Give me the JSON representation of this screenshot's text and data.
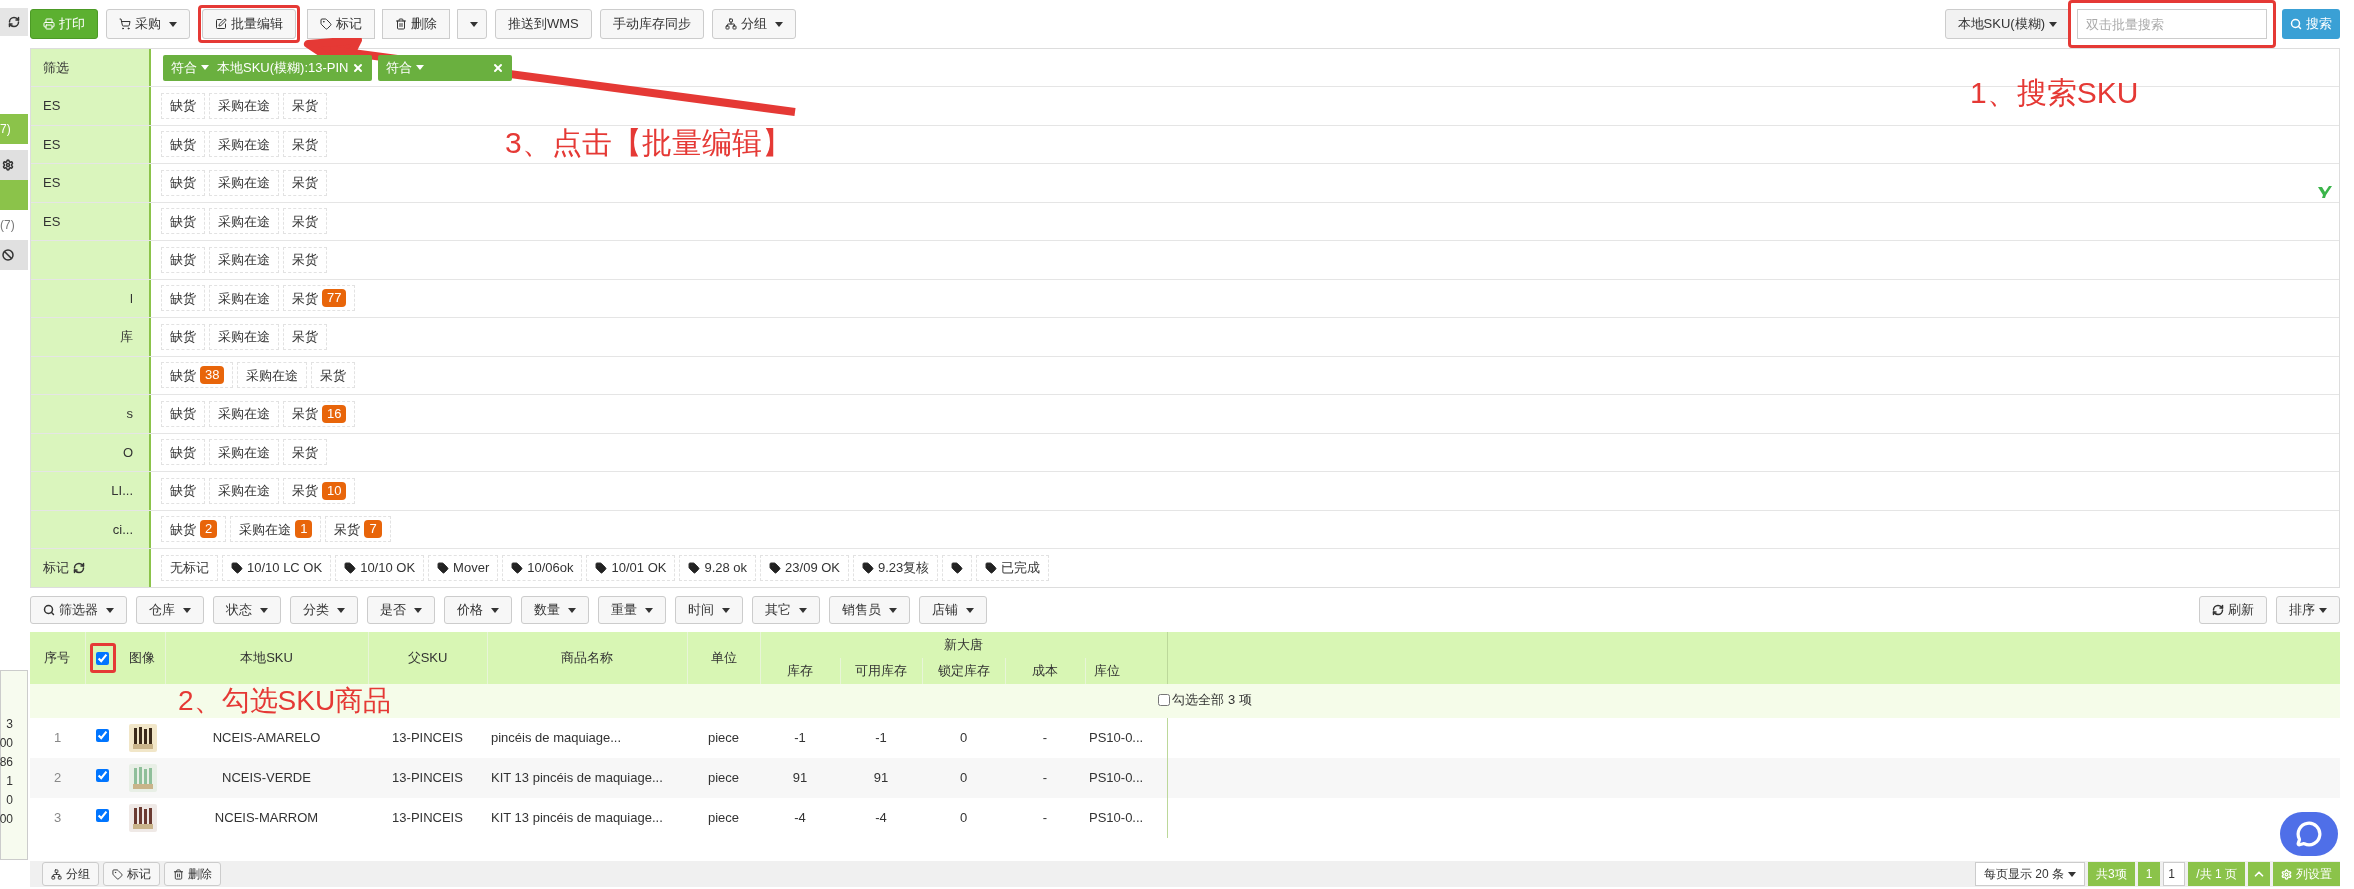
{
  "left_strip": {
    "badge": "7)",
    "count": "(7)",
    "numbers": [
      "3",
      "00",
      "86",
      "1",
      "0",
      "00"
    ]
  },
  "toolbar": {
    "buttons": [
      {
        "label": "打印",
        "kind": "primary",
        "highlighted": false
      },
      {
        "label": "采购",
        "kind": "dropdown",
        "highlighted": false
      },
      {
        "label": "批量编辑",
        "kind": "plain",
        "highlighted": true
      },
      {
        "label": "标记",
        "kind": "group",
        "highlighted": false
      },
      {
        "label": "删除",
        "kind": "group",
        "highlighted": false
      },
      {
        "kind": "caret",
        "highlighted": false
      },
      {
        "label": "推送到WMS",
        "kind": "plain",
        "highlighted": false
      },
      {
        "label": "手动库存同步",
        "kind": "plain",
        "highlighted": false
      },
      {
        "label": "分组",
        "kind": "dropdown",
        "highlighted": false
      }
    ]
  },
  "search": {
    "mode": "本地SKU(模糊)",
    "placeholder": "双击批量搜索",
    "button": "搜索",
    "highlighted": true
  },
  "filter": {
    "label": "筛选",
    "chips": [
      {
        "prefix": "符合",
        "text": "本地SKU(模糊):13-PIN"
      },
      {
        "prefix": "符合"
      }
    ]
  },
  "warehouses": [
    {
      "name": "ES",
      "tags": [
        {
          "label": "缺货"
        },
        {
          "label": "采购在途"
        },
        {
          "label": "呆货"
        }
      ]
    },
    {
      "name": "ES",
      "tags": [
        {
          "label": "缺货"
        },
        {
          "label": "采购在途"
        },
        {
          "label": "呆货"
        }
      ]
    },
    {
      "name": "ES",
      "tags": [
        {
          "label": "缺货"
        },
        {
          "label": "采购在途"
        },
        {
          "label": "呆货"
        }
      ]
    },
    {
      "name": "ES",
      "tags": [
        {
          "label": "缺货"
        },
        {
          "label": "采购在途"
        },
        {
          "label": "呆货"
        }
      ]
    },
    {
      "tags": [
        {
          "label": "缺货"
        },
        {
          "label": "采购在途"
        },
        {
          "label": "呆货"
        }
      ]
    },
    {
      "name": "l",
      "tags": [
        {
          "label": "缺货"
        },
        {
          "label": "采购在途"
        },
        {
          "label": "呆货",
          "count": "77"
        }
      ]
    },
    {
      "name": "库",
      "tags": [
        {
          "label": "缺货"
        },
        {
          "label": "采购在途"
        },
        {
          "label": "呆货"
        }
      ]
    },
    {
      "tags": [
        {
          "label": "缺货",
          "count": "38"
        },
        {
          "label": "采购在途"
        },
        {
          "label": "呆货"
        }
      ]
    },
    {
      "name": "s",
      "tags": [
        {
          "label": "缺货"
        },
        {
          "label": "采购在途"
        },
        {
          "label": "呆货",
          "count": "16"
        }
      ]
    },
    {
      "name": "O",
      "tags": [
        {
          "label": "缺货"
        },
        {
          "label": "采购在途"
        },
        {
          "label": "呆货"
        }
      ]
    },
    {
      "name": "LI...",
      "tags": [
        {
          "label": "缺货"
        },
        {
          "label": "采购在途"
        },
        {
          "label": "呆货",
          "count": "10"
        }
      ]
    },
    {
      "name": "ci...",
      "tags": [
        {
          "label": "缺货",
          "count": "2"
        },
        {
          "label": "采购在途",
          "count": "1"
        },
        {
          "label": "呆货",
          "count": "7"
        }
      ]
    }
  ],
  "marks": {
    "label": "标记",
    "items": [
      {
        "kind": "plain",
        "label": "无标记"
      },
      {
        "kind": "tag",
        "label": "10/10 LC OK"
      },
      {
        "kind": "tag",
        "label": "10/10 OK"
      },
      {
        "kind": "tag",
        "label": "Mover"
      },
      {
        "kind": "tag",
        "label": "10/06ok"
      },
      {
        "kind": "tag",
        "label": "10/01 OK"
      },
      {
        "kind": "tag",
        "label": "9.28 ok"
      },
      {
        "kind": "tag",
        "label": "23/09 OK"
      },
      {
        "kind": "tag",
        "label": "9.23复核"
      },
      {
        "kind": "tag"
      },
      {
        "kind": "tag",
        "label": "已完成"
      }
    ]
  },
  "filter_bar": {
    "buttons": [
      "筛选器",
      "仓库",
      "状态",
      "分类",
      "是否",
      "价格",
      "数量",
      "重量",
      "时间",
      "其它",
      "销售员",
      "店铺"
    ],
    "refresh": "刷新",
    "sort": "排序"
  },
  "table": {
    "columns": [
      "序号",
      "图像",
      "本地SKU",
      "父SKU",
      "商品名称",
      "单位"
    ],
    "group": "新大唐",
    "group_columns": [
      "库存",
      "可用库存",
      "锁定库存",
      "成本",
      "库位"
    ],
    "header_checked": true,
    "header_highlighted": true,
    "select_all": {
      "label": "勾选全部 3 项",
      "checked": false
    },
    "rows": [
      {
        "no": "1",
        "selected": true,
        "sku": "NCEIS-AMARELO",
        "parent": "13-PINCEIS",
        "name": "pincéis de maquiage...",
        "unit": "piece",
        "stock": "-1",
        "available": "-1",
        "locked": "0",
        "cost": "-",
        "location": "PS10-0..."
      },
      {
        "no": "2",
        "selected": true,
        "sku": "NCEIS-VERDE",
        "parent": "13-PINCEIS",
        "name": "KIT 13 pincéis de maquiage...",
        "unit": "piece",
        "stock": "91",
        "available": "91",
        "locked": "0",
        "cost": "-",
        "location": "PS10-0..."
      },
      {
        "no": "3",
        "selected": true,
        "sku": "NCEIS-MARROM",
        "parent": "13-PINCEIS",
        "name": "KIT 13 pincéis de maquiage...",
        "unit": "piece",
        "stock": "-4",
        "available": "-4",
        "locked": "0",
        "cost": "-",
        "location": "PS10-0..."
      }
    ]
  },
  "bottom_actions": [
    "分组",
    "标记",
    "删除"
  ],
  "pagination": {
    "page_size": "每页显示 20 条",
    "total": "共3项",
    "current": "1",
    "page_input": "1",
    "pages": "/共 1 页",
    "settings": "列设置"
  },
  "annotations": [
    {
      "text": "1、搜索SKU"
    },
    {
      "text": "2、勾选SKU商品"
    },
    {
      "text": "3、点击【批量编辑】"
    }
  ]
}
